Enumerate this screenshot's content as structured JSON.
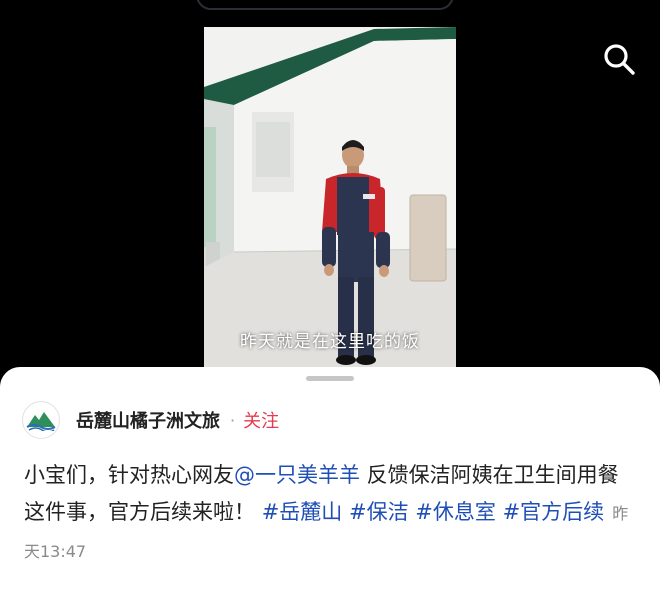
{
  "icons": {
    "search": "search-icon"
  },
  "video": {
    "caption": "昨天就是在这里吃的饭"
  },
  "author": {
    "name": "岳麓山橘子洲文旅",
    "separator": "·",
    "follow_label": "关注"
  },
  "post": {
    "text_intro": "小宝们，针对热心网友",
    "mention": "@一只美羊羊",
    "text_body": " 反馈保洁阿姨在卫生间用餐这件事，官方后续来啦！ ",
    "hashtags": [
      "#岳麓山",
      "#保洁",
      "#休息室",
      "#官方后续"
    ],
    "time": "昨天13:47"
  },
  "colors": {
    "accent_follow": "#e63b4f",
    "link_blue": "#1f4fb6",
    "background": "#000000",
    "sheet": "#ffffff"
  }
}
